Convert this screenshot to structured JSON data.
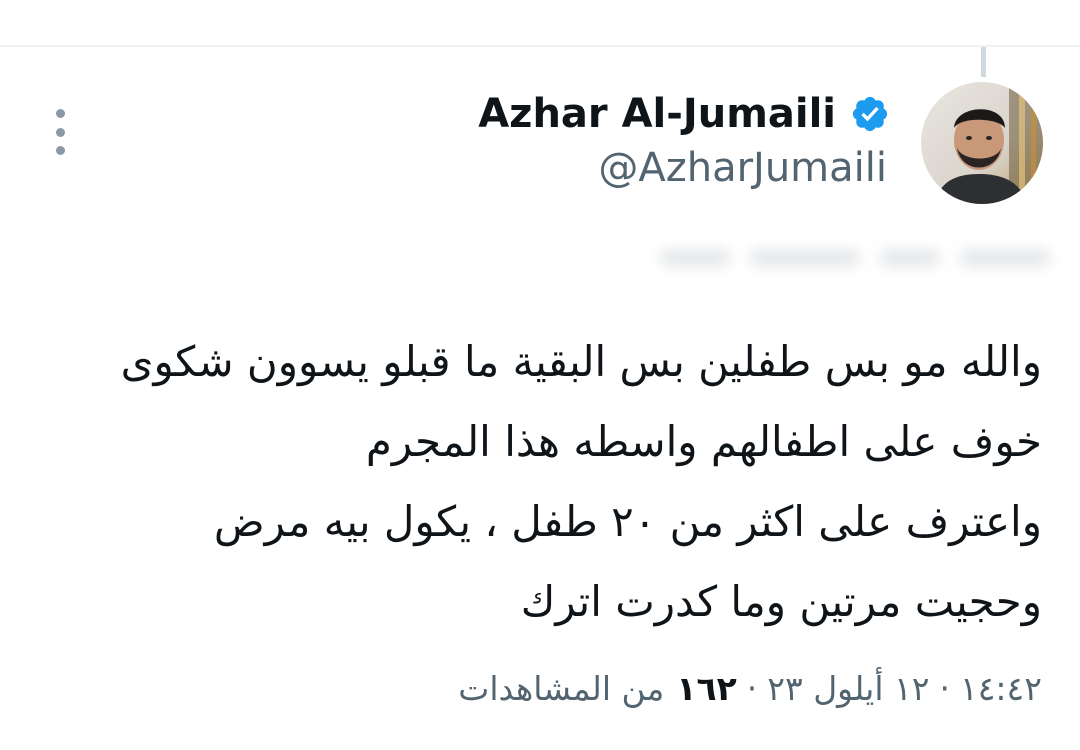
{
  "author": {
    "display_name": "Azhar Al-Jumaili",
    "handle": "@AzharJumaili",
    "verified": true
  },
  "tweet": {
    "lines": [
      "والله مو بس طفلين بس البقية ما قبلو يسوون شكوى",
      "خوف على اطفالهم واسطه هذا المجرم",
      "واعترف على اكثر من ٢٠ طفل ، يكول بيه مرض",
      "وحجيت مرتين وما كدرت اترك"
    ]
  },
  "meta": {
    "time": "١٤:٤٢",
    "separator": "·",
    "date": "١٢ أيلول ٢٣",
    "views_count": "١٦٢",
    "views_label": "من المشاهدات"
  },
  "icons": {
    "more": "more-vertical-icon",
    "verified": "verified-badge-icon"
  },
  "colors": {
    "text_primary": "#0f1419",
    "text_secondary": "#536471",
    "verified_blue": "#1d9bf0",
    "divider": "#eff3f4"
  }
}
